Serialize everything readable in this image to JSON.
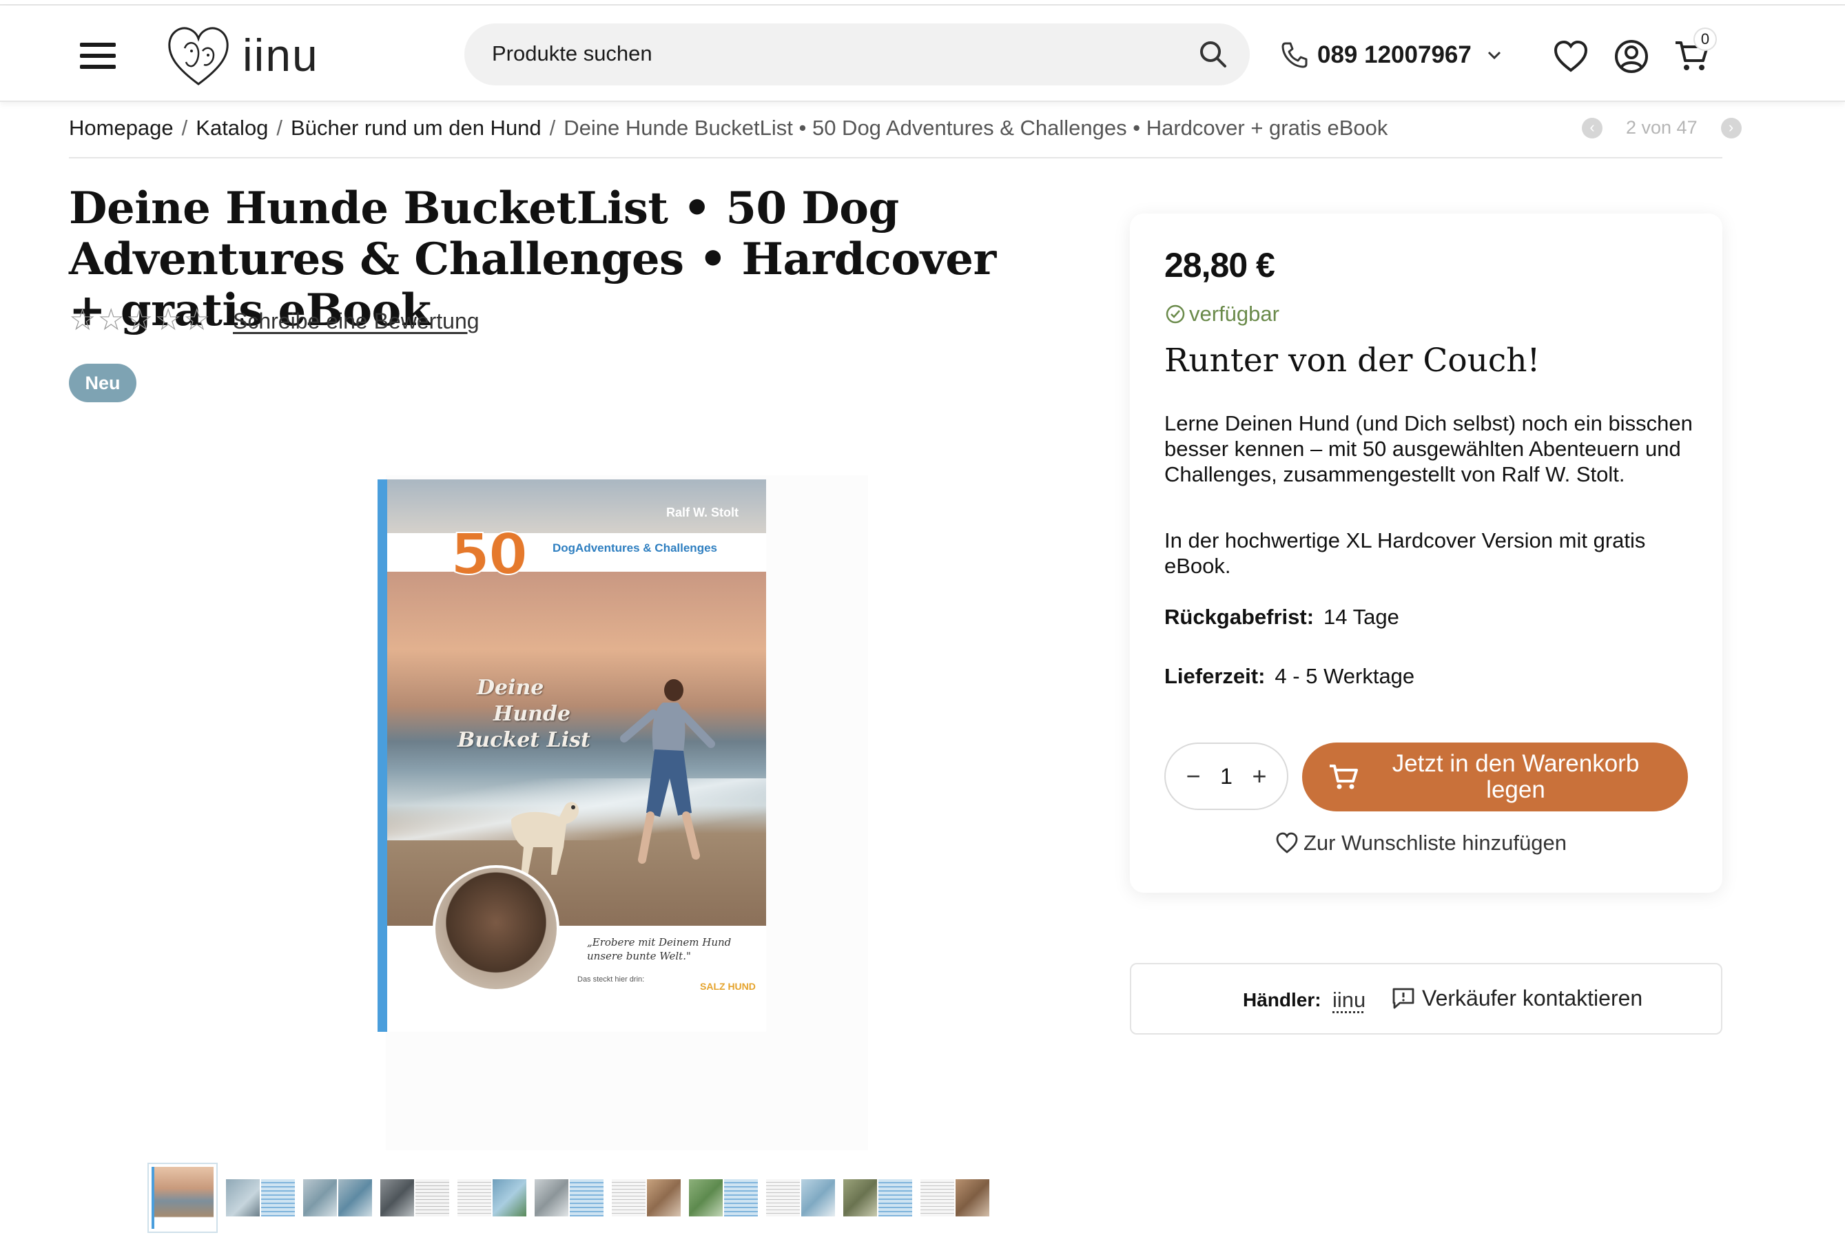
{
  "header": {
    "logo_text": "iinu",
    "search_placeholder": "Produkte suchen",
    "phone": "089 12007967",
    "cart_count": "0"
  },
  "breadcrumb": {
    "items": [
      "Homepage",
      "Katalog",
      "Bücher rund um den Hund"
    ],
    "current": "Deine Hunde BucketList • 50 Dog Adventures & Challenges • Hardcover + gratis eBook",
    "separator": "/"
  },
  "pager": {
    "text": "2 von 47"
  },
  "product": {
    "title": "Deine Hunde BucketList • 50 Dog Adventures & Challenges • Hardcover + gratis eBook",
    "review_link": "Schreibe eine Bewertung",
    "rating_stars": 0,
    "badge": "Neu",
    "cover": {
      "author": "Ralf W. Stolt",
      "number": "50",
      "subtitle": "DogAdventures & Challenges",
      "title_lines": [
        "Deine",
        "Hunde",
        "Bucket List"
      ],
      "quote_lines": [
        "„Erobere mit Deinem Hund",
        "unsere bunte Welt.\""
      ],
      "small_text": "Das steckt hier drin:",
      "logo": "SALZ HUND"
    },
    "thumbnail_count": 11
  },
  "buybox": {
    "price": "28,80 €",
    "availability": "verfügbar",
    "tagline": "Runter von der Couch!",
    "description_1": "Lerne Deinen Hund (und Dich selbst) noch ein bisschen besser kennen – mit 50 ausgewählten Abenteuern und Challenges, zusammengestellt von Ralf W. Stolt.",
    "description_2": "In der hochwertige XL Hardcover Version mit gratis eBook.",
    "return_label": "Rückgabefrist:",
    "return_value": "14 Tage",
    "delivery_label": "Lieferzeit:",
    "delivery_value": "4 - 5 Werktage",
    "quantity": "1",
    "add_to_cart": "Jetzt in den Warenkorb legen",
    "wishlist": "Zur Wunschliste hinzufügen",
    "accent_color": "#c9713a",
    "availability_color": "#6a8a4a"
  },
  "seller": {
    "label": "Händler:",
    "name": "iinu",
    "contact": "Verkäufer kontaktieren"
  }
}
